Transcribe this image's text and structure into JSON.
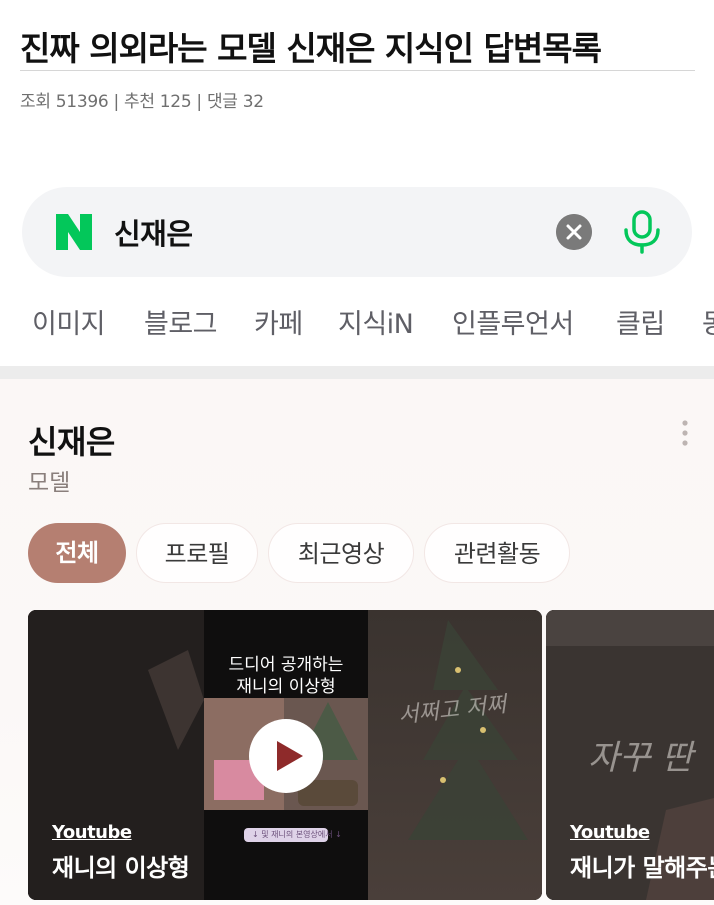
{
  "post": {
    "title": "진짜 의외라는 모델 신재은 지식인 답변목록",
    "meta": "조회 51396 | 추천 125 | 댓글 32"
  },
  "search": {
    "query": "신재은",
    "logo_text": "N",
    "logo_color": "#03c75a"
  },
  "tabs": [
    "이미지",
    "블로그",
    "카페",
    "지식iN",
    "인플루언서",
    "클립",
    "동"
  ],
  "profile": {
    "name": "신재은",
    "job": "모델",
    "pills": [
      "전체",
      "프로필",
      "최근영상",
      "관련활동"
    ]
  },
  "videos": [
    {
      "source": "Youtube",
      "title": "재니의 이상형",
      "thumb_caption_line1": "드디어 공개하는",
      "thumb_caption_line2": "재니의 이상형",
      "thumb_small_text": "↓ 및 재니의 본영상에서 ↓",
      "handwriting": "서쩌고 저쩌"
    },
    {
      "source": "Youtube",
      "title": "재니가 말해주는",
      "handwriting": "자꾸 딴"
    }
  ],
  "colors": {
    "accent_pill": "#b57f71",
    "mic": "#03c75a",
    "naver_green": "#03c75a"
  },
  "icons": {
    "clear": "close-circle-icon",
    "mic": "microphone-icon",
    "more": "more-vertical-icon",
    "play": "play-icon"
  }
}
